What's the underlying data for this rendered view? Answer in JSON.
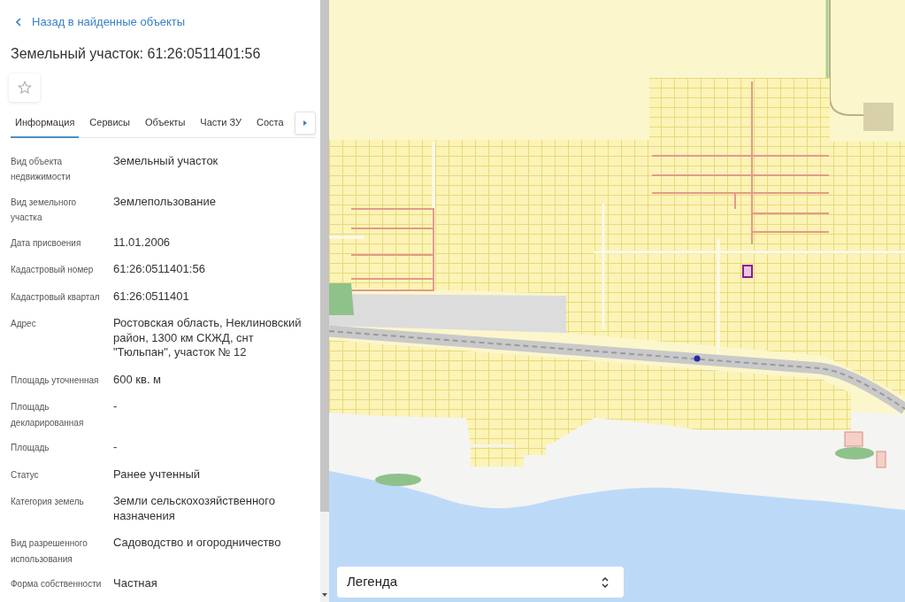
{
  "back_link": {
    "label": "Назад в найденные объекты"
  },
  "title": "Земельный участок: 61:26:0511401:56",
  "favorite": {
    "on": false
  },
  "tabs": [
    {
      "label": "Информация",
      "selected": true
    },
    {
      "label": "Сервисы",
      "selected": false
    },
    {
      "label": "Объекты",
      "selected": false
    },
    {
      "label": "Части ЗУ",
      "selected": false
    },
    {
      "label": "Соста",
      "selected": false
    }
  ],
  "properties": [
    {
      "label": "Вид объекта недвижимости",
      "value": "Земельный участок"
    },
    {
      "label": "Вид земельного участка",
      "value": "Землепользование"
    },
    {
      "label": "Дата присвоения",
      "value": "11.01.2006"
    },
    {
      "label": "Кадастровый номер",
      "value": "61:26:0511401:56"
    },
    {
      "label": "Кадастровый квартал",
      "value": "61:26:0511401"
    },
    {
      "label": "Адрес",
      "value": "Ростовская область, Неклиновский район, 1300 км СКЖД, снт \"Тюльпан\", участок № 12"
    },
    {
      "label": "Площадь уточненная",
      "value": "600 кв. м"
    },
    {
      "label": "Площадь декларированная",
      "value": "-"
    },
    {
      "label": "Площадь",
      "value": "-"
    },
    {
      "label": "Статус",
      "value": "Ранее учтенный"
    },
    {
      "label": "Категория земель",
      "value": "Земли сельскохозяйственного назначения"
    },
    {
      "label": "Вид разрешенного использования",
      "value": "Садоводство и огородничество"
    },
    {
      "label": "Форма собственности",
      "value": "Частная"
    }
  ],
  "legend": {
    "label": "Легенда"
  }
}
